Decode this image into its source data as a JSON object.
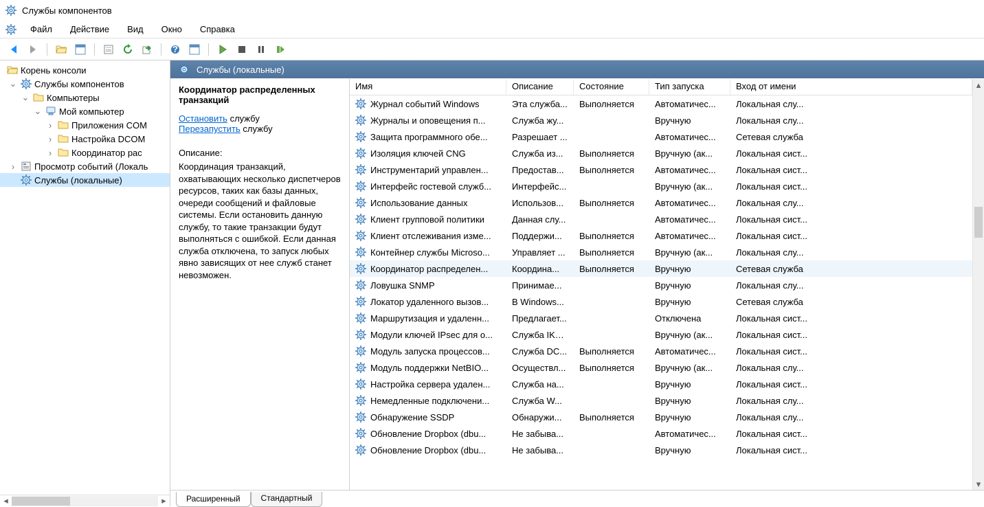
{
  "window": {
    "title": "Службы компонентов"
  },
  "menus": [
    "Файл",
    "Действие",
    "Вид",
    "Окно",
    "Справка"
  ],
  "tree": {
    "root": "Корень консоли",
    "n1": "Службы компонентов",
    "n2": "Компьютеры",
    "n3": "Мой компьютер",
    "n4": "Приложения COM",
    "n5": "Настройка DCOM",
    "n6": "Координатор рас",
    "n7": "Просмотр событий (Локаль",
    "n8": "Службы (локальные)"
  },
  "tab_header": "Службы (локальные)",
  "details": {
    "title": "Координатор распределенных транзакций",
    "stop_link": "Остановить",
    "stop_suffix": " службу",
    "restart_link": "Перезапустить",
    "restart_suffix": " службу",
    "desc_label": "Описание:",
    "desc": "Координация транзакций, охватывающих несколько диспетчеров ресурсов, таких как базы данных, очереди сообщений и файловые системы. Если остановить данную службу, то такие транзакции будут выполняться с ошибкой. Если данная служба отключена, то запуск любых явно зависящих от нее служб станет невозможен."
  },
  "columns": {
    "name": "Имя",
    "desc": "Описание",
    "state": "Состояние",
    "start": "Тип запуска",
    "logon": "Вход от имени"
  },
  "services": [
    {
      "name": "Журнал событий Windows",
      "desc": "Эта служба...",
      "state": "Выполняется",
      "start": "Автоматичес...",
      "logon": "Локальная слу..."
    },
    {
      "name": "Журналы и оповещения п...",
      "desc": "Служба жу...",
      "state": "",
      "start": "Вручную",
      "logon": "Локальная слу..."
    },
    {
      "name": "Защита программного обе...",
      "desc": "Разрешает ...",
      "state": "",
      "start": "Автоматичес...",
      "logon": "Сетевая служба"
    },
    {
      "name": "Изоляция ключей CNG",
      "desc": "Служба из...",
      "state": "Выполняется",
      "start": "Вручную (ак...",
      "logon": "Локальная сист..."
    },
    {
      "name": "Инструментарий управлен...",
      "desc": "Предостав...",
      "state": "Выполняется",
      "start": "Автоматичес...",
      "logon": "Локальная сист..."
    },
    {
      "name": "Интерфейс гостевой служб...",
      "desc": "Интерфейс...",
      "state": "",
      "start": "Вручную (ак...",
      "logon": "Локальная сист..."
    },
    {
      "name": "Использование данных",
      "desc": "Использов...",
      "state": "Выполняется",
      "start": "Автоматичес...",
      "logon": "Локальная слу..."
    },
    {
      "name": "Клиент групповой политики",
      "desc": "Данная слу...",
      "state": "",
      "start": "Автоматичес...",
      "logon": "Локальная сист..."
    },
    {
      "name": "Клиент отслеживания изме...",
      "desc": "Поддержи...",
      "state": "Выполняется",
      "start": "Автоматичес...",
      "logon": "Локальная сист..."
    },
    {
      "name": "Контейнер службы Microso...",
      "desc": "Управляет ...",
      "state": "Выполняется",
      "start": "Вручную (ак...",
      "logon": "Локальная слу..."
    },
    {
      "name": "Координатор распределен...",
      "desc": "Координа...",
      "state": "Выполняется",
      "start": "Вручную",
      "logon": "Сетевая служба",
      "selected": true
    },
    {
      "name": "Ловушка SNMP",
      "desc": "Принимае...",
      "state": "",
      "start": "Вручную",
      "logon": "Локальная слу..."
    },
    {
      "name": "Локатор удаленного вызов...",
      "desc": "В Windows...",
      "state": "",
      "start": "Вручную",
      "logon": "Сетевая служба"
    },
    {
      "name": "Маршрутизация и удаленн...",
      "desc": "Предлагает...",
      "state": "",
      "start": "Отключена",
      "logon": "Локальная сист..."
    },
    {
      "name": "Модули ключей IPsec для о...",
      "desc": "Служба IKE...",
      "state": "",
      "start": "Вручную (ак...",
      "logon": "Локальная сист..."
    },
    {
      "name": "Модуль запуска процессов...",
      "desc": "Служба DC...",
      "state": "Выполняется",
      "start": "Автоматичес...",
      "logon": "Локальная сист..."
    },
    {
      "name": "Модуль поддержки NetBIO...",
      "desc": "Осуществл...",
      "state": "Выполняется",
      "start": "Вручную (ак...",
      "logon": "Локальная слу..."
    },
    {
      "name": "Настройка сервера удален...",
      "desc": "Служба на...",
      "state": "",
      "start": "Вручную",
      "logon": "Локальная сист..."
    },
    {
      "name": "Немедленные подключени...",
      "desc": "Служба W...",
      "state": "",
      "start": "Вручную",
      "logon": "Локальная слу..."
    },
    {
      "name": "Обнаружение SSDP",
      "desc": "Обнаружи...",
      "state": "Выполняется",
      "start": "Вручную",
      "logon": "Локальная слу..."
    },
    {
      "name": "Обновление Dropbox (dbu...",
      "desc": "Не забыва...",
      "state": "",
      "start": "Автоматичес...",
      "logon": "Локальная сист..."
    },
    {
      "name": "Обновление Dropbox (dbu...",
      "desc": "Не забыва...",
      "state": "",
      "start": "Вручную",
      "logon": "Локальная сист..."
    }
  ],
  "bottom_tabs": {
    "extended": "Расширенный",
    "standard": "Стандартный"
  }
}
